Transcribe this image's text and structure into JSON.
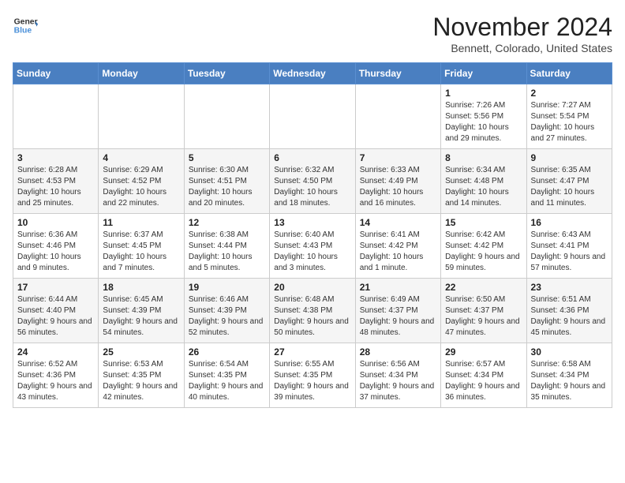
{
  "header": {
    "logo_line1": "General",
    "logo_line2": "Blue",
    "month": "November 2024",
    "location": "Bennett, Colorado, United States"
  },
  "weekdays": [
    "Sunday",
    "Monday",
    "Tuesday",
    "Wednesday",
    "Thursday",
    "Friday",
    "Saturday"
  ],
  "weeks": [
    [
      {
        "day": "",
        "info": ""
      },
      {
        "day": "",
        "info": ""
      },
      {
        "day": "",
        "info": ""
      },
      {
        "day": "",
        "info": ""
      },
      {
        "day": "",
        "info": ""
      },
      {
        "day": "1",
        "info": "Sunrise: 7:26 AM\nSunset: 5:56 PM\nDaylight: 10 hours and 29 minutes."
      },
      {
        "day": "2",
        "info": "Sunrise: 7:27 AM\nSunset: 5:54 PM\nDaylight: 10 hours and 27 minutes."
      }
    ],
    [
      {
        "day": "3",
        "info": "Sunrise: 6:28 AM\nSunset: 4:53 PM\nDaylight: 10 hours and 25 minutes."
      },
      {
        "day": "4",
        "info": "Sunrise: 6:29 AM\nSunset: 4:52 PM\nDaylight: 10 hours and 22 minutes."
      },
      {
        "day": "5",
        "info": "Sunrise: 6:30 AM\nSunset: 4:51 PM\nDaylight: 10 hours and 20 minutes."
      },
      {
        "day": "6",
        "info": "Sunrise: 6:32 AM\nSunset: 4:50 PM\nDaylight: 10 hours and 18 minutes."
      },
      {
        "day": "7",
        "info": "Sunrise: 6:33 AM\nSunset: 4:49 PM\nDaylight: 10 hours and 16 minutes."
      },
      {
        "day": "8",
        "info": "Sunrise: 6:34 AM\nSunset: 4:48 PM\nDaylight: 10 hours and 14 minutes."
      },
      {
        "day": "9",
        "info": "Sunrise: 6:35 AM\nSunset: 4:47 PM\nDaylight: 10 hours and 11 minutes."
      }
    ],
    [
      {
        "day": "10",
        "info": "Sunrise: 6:36 AM\nSunset: 4:46 PM\nDaylight: 10 hours and 9 minutes."
      },
      {
        "day": "11",
        "info": "Sunrise: 6:37 AM\nSunset: 4:45 PM\nDaylight: 10 hours and 7 minutes."
      },
      {
        "day": "12",
        "info": "Sunrise: 6:38 AM\nSunset: 4:44 PM\nDaylight: 10 hours and 5 minutes."
      },
      {
        "day": "13",
        "info": "Sunrise: 6:40 AM\nSunset: 4:43 PM\nDaylight: 10 hours and 3 minutes."
      },
      {
        "day": "14",
        "info": "Sunrise: 6:41 AM\nSunset: 4:42 PM\nDaylight: 10 hours and 1 minute."
      },
      {
        "day": "15",
        "info": "Sunrise: 6:42 AM\nSunset: 4:42 PM\nDaylight: 9 hours and 59 minutes."
      },
      {
        "day": "16",
        "info": "Sunrise: 6:43 AM\nSunset: 4:41 PM\nDaylight: 9 hours and 57 minutes."
      }
    ],
    [
      {
        "day": "17",
        "info": "Sunrise: 6:44 AM\nSunset: 4:40 PM\nDaylight: 9 hours and 56 minutes."
      },
      {
        "day": "18",
        "info": "Sunrise: 6:45 AM\nSunset: 4:39 PM\nDaylight: 9 hours and 54 minutes."
      },
      {
        "day": "19",
        "info": "Sunrise: 6:46 AM\nSunset: 4:39 PM\nDaylight: 9 hours and 52 minutes."
      },
      {
        "day": "20",
        "info": "Sunrise: 6:48 AM\nSunset: 4:38 PM\nDaylight: 9 hours and 50 minutes."
      },
      {
        "day": "21",
        "info": "Sunrise: 6:49 AM\nSunset: 4:37 PM\nDaylight: 9 hours and 48 minutes."
      },
      {
        "day": "22",
        "info": "Sunrise: 6:50 AM\nSunset: 4:37 PM\nDaylight: 9 hours and 47 minutes."
      },
      {
        "day": "23",
        "info": "Sunrise: 6:51 AM\nSunset: 4:36 PM\nDaylight: 9 hours and 45 minutes."
      }
    ],
    [
      {
        "day": "24",
        "info": "Sunrise: 6:52 AM\nSunset: 4:36 PM\nDaylight: 9 hours and 43 minutes."
      },
      {
        "day": "25",
        "info": "Sunrise: 6:53 AM\nSunset: 4:35 PM\nDaylight: 9 hours and 42 minutes."
      },
      {
        "day": "26",
        "info": "Sunrise: 6:54 AM\nSunset: 4:35 PM\nDaylight: 9 hours and 40 minutes."
      },
      {
        "day": "27",
        "info": "Sunrise: 6:55 AM\nSunset: 4:35 PM\nDaylight: 9 hours and 39 minutes."
      },
      {
        "day": "28",
        "info": "Sunrise: 6:56 AM\nSunset: 4:34 PM\nDaylight: 9 hours and 37 minutes."
      },
      {
        "day": "29",
        "info": "Sunrise: 6:57 AM\nSunset: 4:34 PM\nDaylight: 9 hours and 36 minutes."
      },
      {
        "day": "30",
        "info": "Sunrise: 6:58 AM\nSunset: 4:34 PM\nDaylight: 9 hours and 35 minutes."
      }
    ]
  ]
}
